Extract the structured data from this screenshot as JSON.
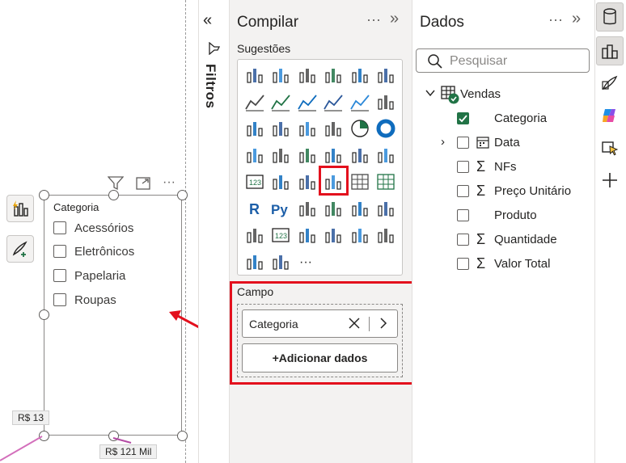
{
  "canvas": {
    "slicer": {
      "title": "Categoria",
      "items": [
        "Acessórios",
        "Eletrônicos",
        "Papelaria",
        "Roupas"
      ]
    },
    "bubble_left": "R$ 13",
    "bubble_bottom": "R$ 121 Mil",
    "accent_color": "#e3101d"
  },
  "filters": {
    "label": "Filtros"
  },
  "build_pane": {
    "title": "Compilar",
    "more": "···",
    "collapse": "»",
    "suggestions_label": "Sugestões",
    "gallery_icons": [
      "stacked-bar-icon",
      "clustered-bar-icon",
      "stacked-bar-100-icon",
      "clustered-column-icon",
      "stacked-column-icon",
      "column-100-icon",
      "line-chart-icon",
      "area-chart-icon",
      "stacked-area-icon",
      "line-area-icon",
      "line-column-icon",
      "ribbon-combo-icon",
      "ribbon-chart-icon",
      "waterfall-icon",
      "funnel-icon",
      "scatter-icon",
      "pie-chart-icon",
      "donut-chart-icon",
      "treemap-icon",
      "map-icon",
      "filled-map-icon",
      "shape-map-icon",
      "azure-map-icon",
      "gauge-icon",
      "card-icon",
      "multi-row-card-icon",
      "kpi-icon",
      "slicer-icon",
      "table-icon",
      "matrix-icon",
      "r-visual-icon",
      "python-visual-icon",
      "key-influencers-icon",
      "decomposition-tree-icon",
      "qa-icon",
      "narrative-icon",
      "goals-icon",
      "paginated-report-icon",
      "power-apps-icon",
      "power-automate-icon",
      "button-slicer-icon",
      "more-visuals-icon",
      "app-icon",
      "arrow-visual-icon",
      "ellipsis-icon"
    ],
    "more_visuals": "···",
    "field_well": {
      "label": "Campo",
      "field": "Categoria",
      "add_button": "+Adicionar dados"
    }
  },
  "data_pane": {
    "title": "Dados",
    "more": "···",
    "collapse": "»",
    "search_placeholder": "Pesquisar",
    "table": "Vendas",
    "fields": [
      {
        "name": "Categoria",
        "checked": true,
        "sigma": false,
        "expandable": false,
        "icon": "none"
      },
      {
        "name": "Data",
        "checked": false,
        "sigma": false,
        "expandable": true,
        "icon": "calendar-icon"
      },
      {
        "name": "NFs",
        "checked": false,
        "sigma": true,
        "expandable": false,
        "icon": "sigma-icon"
      },
      {
        "name": "Preço Unitário",
        "checked": false,
        "sigma": true,
        "expandable": false,
        "icon": "sigma-icon"
      },
      {
        "name": "Produto",
        "checked": false,
        "sigma": false,
        "expandable": false,
        "icon": "none"
      },
      {
        "name": "Quantidade",
        "checked": false,
        "sigma": true,
        "expandable": false,
        "icon": "sigma-icon"
      },
      {
        "name": "Valor Total",
        "checked": false,
        "sigma": true,
        "expandable": false,
        "icon": "sigma-icon"
      }
    ]
  },
  "right_rail": {
    "buttons": [
      "data-icon",
      "build-icon",
      "format-icon",
      "copilot-icon",
      "selection-icon",
      "add-pane-icon"
    ]
  }
}
